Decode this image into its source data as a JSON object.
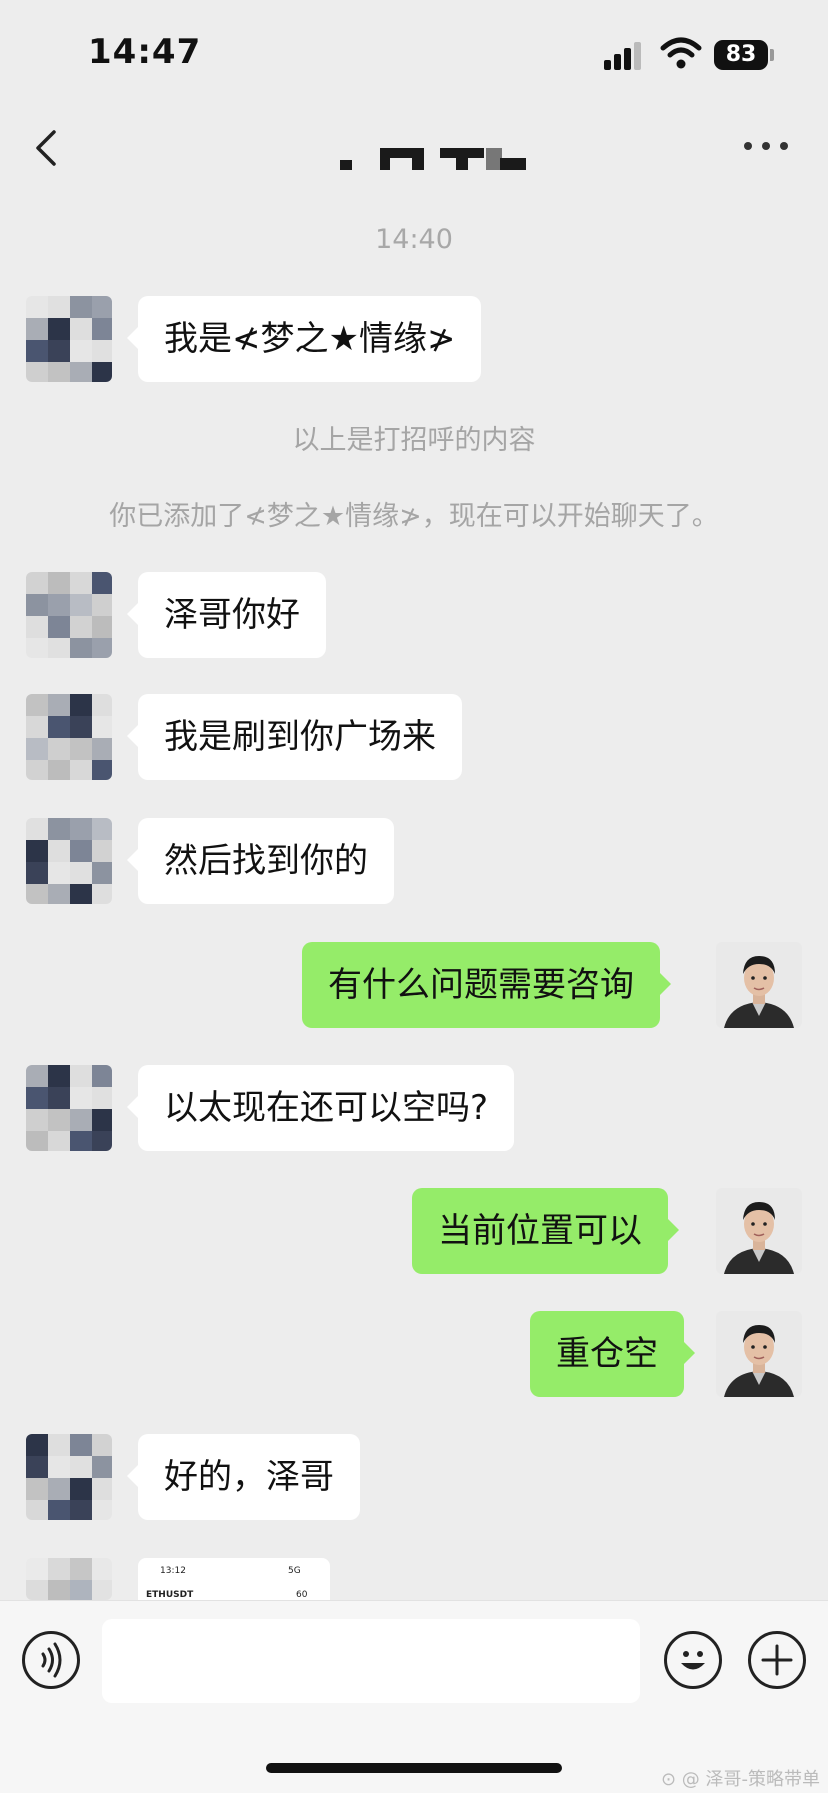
{
  "status_bar": {
    "time": "14:47",
    "battery": "83"
  },
  "nav": {
    "title": ""
  },
  "chat": {
    "timestamp": "14:40",
    "messages": [
      {
        "side": "in",
        "text": "我是≮梦之★情缘≯"
      },
      {
        "side": "in",
        "text": "泽哥你好"
      },
      {
        "side": "in",
        "text": "我是刷到你广场来"
      },
      {
        "side": "in",
        "text": "然后找到你的"
      },
      {
        "side": "out",
        "text": "有什么问题需要咨询"
      },
      {
        "side": "in",
        "text": "以太现在还可以空吗?"
      },
      {
        "side": "out",
        "text": "当前位置可以"
      },
      {
        "side": "out",
        "text": "重仓空"
      },
      {
        "side": "in",
        "text": "好的，泽哥"
      }
    ],
    "system_notes": [
      "以上是打招呼的内容",
      "你已添加了≮梦之★情缘≯，现在可以开始聊天了。"
    ],
    "image_message": {
      "time": "13:12",
      "symbol": "ETHUSDT",
      "network": "5G",
      "value": "60"
    }
  },
  "input": {
    "placeholder": ""
  },
  "watermark": "⊙ @ 泽哥-策略带单",
  "colors": {
    "background": "#ededed",
    "incoming_bubble": "#ffffff",
    "outgoing_bubble": "#95ec69"
  }
}
